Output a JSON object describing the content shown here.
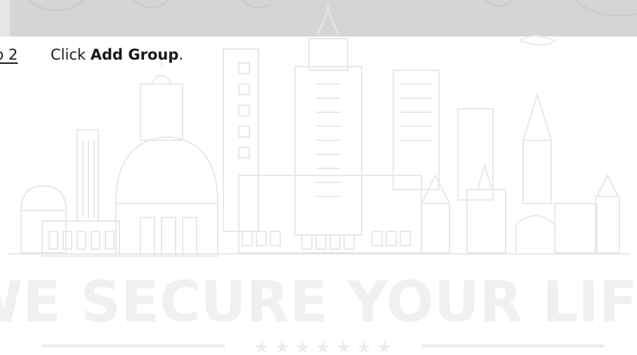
{
  "step": {
    "label": "p 2",
    "prefix": "Click ",
    "action": "Add Group",
    "suffix": "."
  },
  "watermark": {
    "tagline": "WE SECURE YOUR LIFE",
    "stars": "★ ★ ★ ★ ★ ★ ★",
    "line_color": "#e9e9e9",
    "text_color": "#f0f0f0"
  },
  "colors": {
    "band": "#d5d5d5",
    "text": "#1a1a1a"
  }
}
